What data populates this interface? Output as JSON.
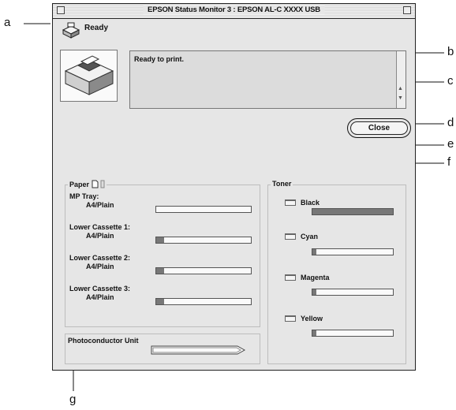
{
  "window": {
    "title": "EPSON Status Monitor 3 : EPSON AL-C XXXX USB"
  },
  "status": {
    "label": "Ready",
    "message": "Ready to print."
  },
  "buttons": {
    "close": "Close"
  },
  "paper": {
    "group_label": "Paper",
    "trays": [
      {
        "name": "MP Tray:",
        "media": "A4/Plain",
        "level": 0
      },
      {
        "name": "Lower Cassette 1:",
        "media": "A4/Plain",
        "level": 0.08
      },
      {
        "name": "Lower Cassette 2:",
        "media": "A4/Plain",
        "level": 0.08
      },
      {
        "name": "Lower Cassette 3:",
        "media": "A4/Plain",
        "level": 0.08
      }
    ]
  },
  "toner": {
    "group_label": "Toner",
    "colors": [
      {
        "name": "Black",
        "level": 1.0
      },
      {
        "name": "Cyan",
        "level": 0.05
      },
      {
        "name": "Magenta",
        "level": 0.05
      },
      {
        "name": "Yellow",
        "level": 0.05
      }
    ]
  },
  "photoconductor": {
    "label": "Photoconductor Unit",
    "level": 0.0
  },
  "callouts": [
    "a",
    "b",
    "c",
    "d",
    "e",
    "f",
    "g"
  ]
}
